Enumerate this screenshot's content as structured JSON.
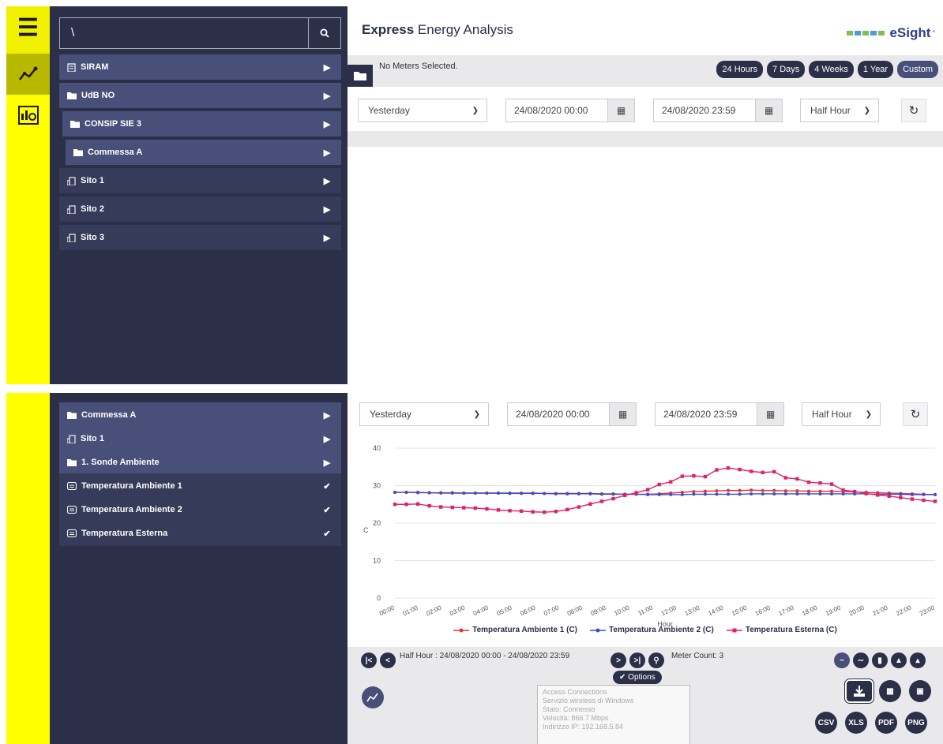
{
  "app": {
    "title_bold": "Express",
    "title_rest": " Energy Analysis",
    "logo_text": "eSight",
    "logo_mark": "°",
    "logo_colors": [
      "#7fbf4d",
      "#4a9fd6",
      "#7fbf4d",
      "#4a9fd6",
      "#7fbf4d",
      "#4a9fd6"
    ]
  },
  "rail": {
    "items": [
      {
        "icon": "menu-icon"
      },
      {
        "icon": "analysis-line-icon",
        "active": true
      },
      {
        "icon": "report-dashboard-icon"
      }
    ]
  },
  "search": {
    "value": "\\",
    "icon": "search-icon"
  },
  "tree_top": [
    {
      "label": "SIRAM",
      "type": "folder",
      "icon": "building-icon"
    },
    {
      "label": "UdB NO",
      "type": "folder",
      "icon": "folder-icon"
    },
    {
      "label": "CONSIP SIE 3",
      "type": "folder",
      "icon": "folder-icon"
    },
    {
      "label": "Commessa A",
      "type": "folder",
      "icon": "folder-icon"
    },
    {
      "label": "Sito 1",
      "type": "leaf",
      "icon": "site-icon"
    },
    {
      "label": "Sito 2",
      "type": "leaf",
      "icon": "site-icon"
    },
    {
      "label": "Sito 3",
      "type": "leaf",
      "icon": "site-icon"
    }
  ],
  "tree_bottom": [
    {
      "label": "Commessa A",
      "type": "folder",
      "icon": "folder-icon",
      "marker": "arrow"
    },
    {
      "label": "Sito 1",
      "type": "folder",
      "icon": "site-icon",
      "marker": "arrow"
    },
    {
      "label": "1. Sonde Ambiente",
      "type": "folder",
      "icon": "folder-icon",
      "marker": "arrow"
    },
    {
      "label": "Temperatura Ambiente 1",
      "type": "leaf",
      "icon": "meter-icon",
      "marker": "check"
    },
    {
      "label": "Temperatura Ambiente 2",
      "type": "leaf",
      "icon": "meter-icon",
      "marker": "check"
    },
    {
      "label": "Temperatura Esterna",
      "type": "leaf",
      "icon": "meter-icon",
      "marker": "check"
    }
  ],
  "meters": {
    "message": "No Meters Selected."
  },
  "ranges": [
    "24 Hours",
    "7 Days",
    "4 Weeks",
    "1 Year",
    "Custom"
  ],
  "controls": {
    "period": "Yesterday",
    "start": "24/08/2020 00:00",
    "end": "24/08/2020 23:59",
    "interval": "Half Hour"
  },
  "toolbar": {
    "range_text": "Half Hour : 24/08/2020 00:00 - 24/08/2020 23:59",
    "meter_count": "Meter Count: 3",
    "options_label": "Options",
    "exports": [
      "CSV",
      "XLS",
      "PDF",
      "PNG"
    ],
    "tooltip_lines": [
      "Access Connections",
      "Servizio wireless di Windows",
      "Stato: Connesso",
      "Velocità: 866.7 Mbps",
      "Indirizzo IP: 192.168.5.84"
    ]
  },
  "chart_data": {
    "type": "line",
    "xlabel": "Hour",
    "ylabel": "C",
    "ylim": [
      0,
      40
    ],
    "yticks": [
      0,
      10,
      20,
      30,
      40
    ],
    "xticks": [
      "00:00",
      "01:00",
      "02:00",
      "03:00",
      "04:00",
      "05:00",
      "06:00",
      "07:00",
      "08:00",
      "09:00",
      "10:00",
      "11:00",
      "12:00",
      "13:00",
      "14:00",
      "15:00",
      "16:00",
      "17:00",
      "18:00",
      "19:00",
      "20:00",
      "21:00",
      "22:00",
      "23:00"
    ],
    "grid": true,
    "legend_position": "bottom",
    "series": [
      {
        "name": "Temperatura Ambiente 1 (C)",
        "color": "#e8303a",
        "values": [
          28.2,
          28.2,
          28.1,
          28.1,
          28.0,
          28.0,
          28.0,
          28.0,
          28.0,
          28.0,
          27.9,
          27.9,
          27.9,
          27.9,
          27.8,
          27.8,
          27.8,
          27.8,
          27.7,
          27.7,
          27.7,
          27.7,
          27.7,
          27.8,
          28.0,
          28.2,
          28.4,
          28.5,
          28.6,
          28.7,
          28.7,
          28.8,
          28.7,
          28.7,
          28.6,
          28.6,
          28.5,
          28.5,
          28.5,
          28.4,
          28.3,
          28.2,
          28.1,
          28.0,
          27.9,
          27.8,
          27.7,
          27.6
        ]
      },
      {
        "name": "Temperatura Ambiente 2 (C)",
        "color": "#3a4fc8",
        "values": [
          28.2,
          28.2,
          28.2,
          28.1,
          28.1,
          28.1,
          28.0,
          28.0,
          28.0,
          28.0,
          28.0,
          28.0,
          28.0,
          27.9,
          27.9,
          27.9,
          27.9,
          27.9,
          27.8,
          27.8,
          27.7,
          27.7,
          27.6,
          27.6,
          27.6,
          27.6,
          27.7,
          27.7,
          27.7,
          27.7,
          27.7,
          27.8,
          27.8,
          27.8,
          27.8,
          27.8,
          27.8,
          27.8,
          27.8,
          27.8,
          27.8,
          27.8,
          27.7,
          27.7,
          27.7,
          27.6,
          27.6,
          27.6
        ]
      },
      {
        "name": "Temperatura Esterna (C)",
        "color": "#e0206a",
        "values": [
          25.0,
          25.0,
          25.1,
          24.6,
          24.3,
          24.2,
          24.1,
          24.0,
          23.8,
          23.5,
          23.3,
          23.2,
          23.0,
          22.9,
          23.1,
          23.6,
          24.3,
          25.1,
          25.8,
          26.5,
          27.4,
          28.1,
          28.9,
          30.3,
          31.0,
          32.5,
          32.6,
          32.4,
          34.2,
          34.7,
          34.3,
          33.8,
          33.5,
          33.7,
          32.1,
          31.8,
          30.9,
          30.7,
          30.4,
          28.8,
          28.4,
          27.9,
          27.5,
          27.2,
          26.8,
          26.4,
          26.1,
          25.8
        ]
      }
    ]
  }
}
